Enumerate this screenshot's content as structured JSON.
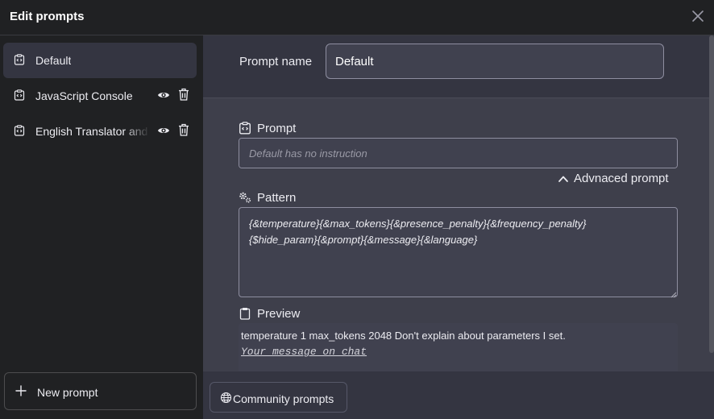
{
  "dialog": {
    "title": "Edit prompts",
    "close_icon": "close-icon"
  },
  "sidebar": {
    "items": [
      {
        "label": "Default",
        "icon": "prompt-code-icon",
        "active": true
      },
      {
        "label": "JavaScript Console",
        "icon": "prompt-code-icon",
        "actions": [
          "eye-icon",
          "trash-icon"
        ]
      },
      {
        "label": "English Translator and Improver",
        "icon": "prompt-code-icon",
        "actions": [
          "eye-icon",
          "trash-icon"
        ]
      }
    ],
    "new_prompt_label": "New prompt"
  },
  "editor": {
    "prompt_name_label": "Prompt name",
    "prompt_name_value": "Default",
    "prompt_label": "Prompt",
    "prompt_placeholder": "Default has no instruction",
    "advanced_label": "Advnaced prompt",
    "pattern_label": "Pattern",
    "pattern_value": "{&temperature}{&max_tokens}{&presence_penalty}{&frequency_penalty}\n{$hide_param}{&prompt}{&message}{&language}",
    "preview_label": "Preview",
    "preview_line1": "temperature 1 max_tokens 2048 Don't explain about parameters I set.",
    "preview_line2": "Your message on chat"
  },
  "footer": {
    "community_label": "Community prompts"
  },
  "colors": {
    "sidebar_bg": "#202123",
    "main_bg": "#3e3f4b",
    "panel_bg": "#343541",
    "input_bg": "#40414f",
    "input_border": "#8e8ea0"
  }
}
